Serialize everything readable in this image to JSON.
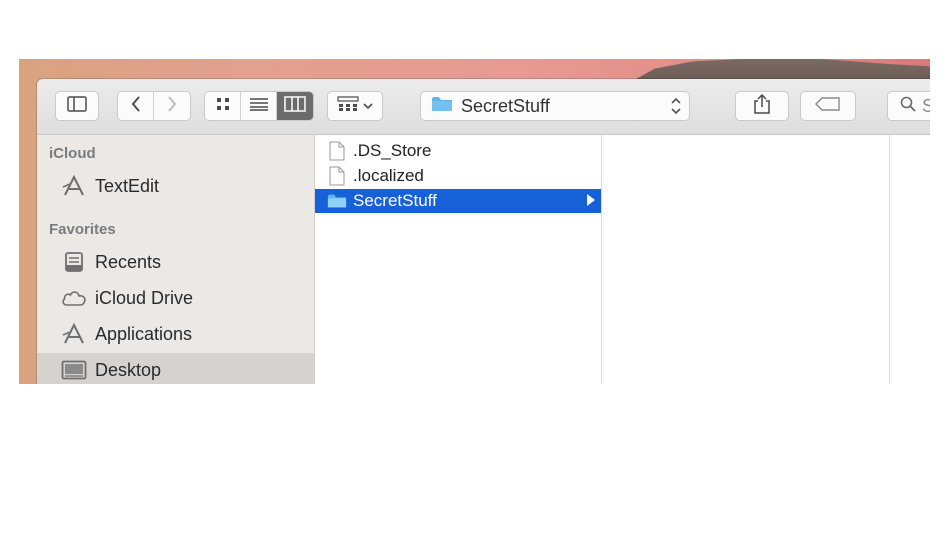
{
  "colors": {
    "selection": "#1660d8",
    "folder": "#5fb6ee",
    "sidebar_bg": "#ebe8e6",
    "active_view": "#6c6c6c"
  },
  "toolbar": {
    "path_label": "SecretStuff",
    "search_placeholder": "Se",
    "icons": [
      "sidebar-toggle-icon",
      "back-icon",
      "forward-icon",
      "icon-view-icon",
      "list-view-icon",
      "column-view-icon",
      "arrange-icon",
      "chevron-down-icon",
      "folder-icon",
      "up-down-icon",
      "share-icon",
      "tag-icon",
      "search-icon"
    ]
  },
  "sidebar": {
    "sections": [
      {
        "title": "iCloud",
        "items": [
          {
            "label": "TextEdit",
            "icon": "app-icon"
          }
        ]
      },
      {
        "title": "Favorites",
        "items": [
          {
            "label": "Recents",
            "icon": "recents-icon"
          },
          {
            "label": "iCloud Drive",
            "icon": "cloud-icon"
          },
          {
            "label": "Applications",
            "icon": "app-icon"
          },
          {
            "label": "Desktop",
            "icon": "desktop-icon",
            "selected": true
          }
        ]
      }
    ]
  },
  "columns": [
    {
      "files": [
        {
          "name": ".DS_Store",
          "type": "document"
        },
        {
          "name": ".localized",
          "type": "document"
        },
        {
          "name": "SecretStuff",
          "type": "folder",
          "selected": true
        }
      ]
    },
    {
      "files": []
    },
    {
      "files": []
    }
  ]
}
